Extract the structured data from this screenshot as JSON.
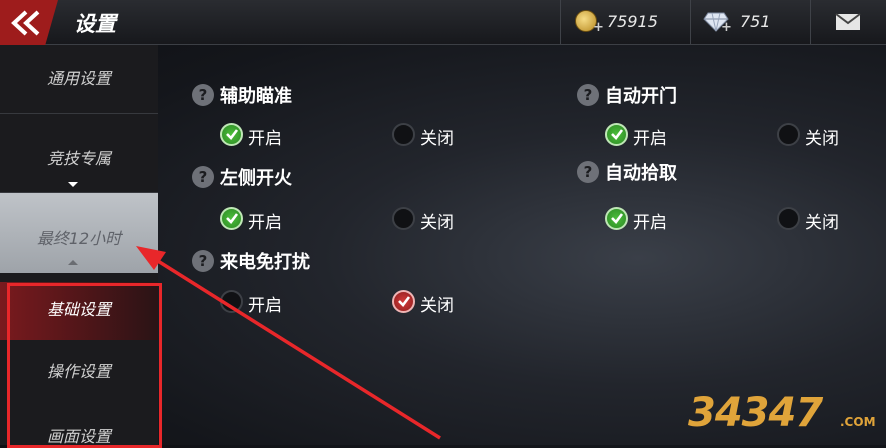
{
  "header": {
    "title": "设置",
    "gold_amount": "75915",
    "diamond_amount": "751"
  },
  "sidebar": {
    "items": [
      {
        "label": "通用设置"
      },
      {
        "label": "竞技专属"
      },
      {
        "label": "最终12小时"
      },
      {
        "label": "基础设置"
      },
      {
        "label": "操作设置"
      },
      {
        "label": "画面设置"
      }
    ]
  },
  "settings": [
    {
      "title": "辅助瞄准",
      "on": "开启",
      "off": "关闭",
      "selected": "on"
    },
    {
      "title": "自动开门",
      "on": "开启",
      "off": "关闭",
      "selected": "on"
    },
    {
      "title": "左侧开火",
      "on": "开启",
      "off": "关闭",
      "selected": "on"
    },
    {
      "title": "自动拾取",
      "on": "开启",
      "off": "关闭",
      "selected": "on"
    },
    {
      "title": "来电免打扰",
      "on": "开启",
      "off": "关闭",
      "selected": "off"
    }
  ],
  "watermark": {
    "text": "34347",
    "suffix": ".COM"
  },
  "colors": {
    "accent_red": "#9e1c1c",
    "check_green": "#2c8a24",
    "check_red": "#c42b2b",
    "annotation": "#e8272a"
  }
}
